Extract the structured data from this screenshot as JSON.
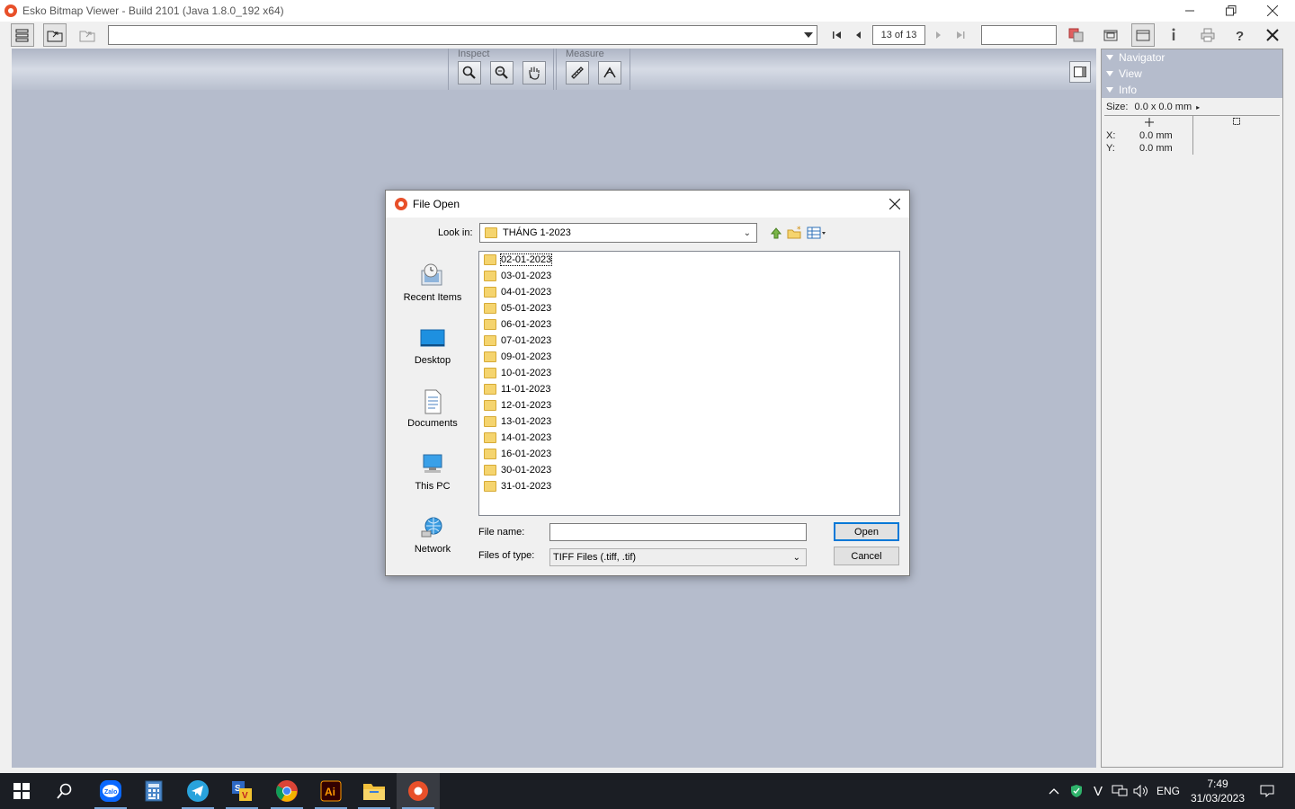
{
  "window": {
    "title": "Esko Bitmap Viewer - Build 2101 (Java 1.8.0_192 x64)",
    "controls": [
      "minimize",
      "maximize",
      "close"
    ]
  },
  "toolbar": {
    "path_value": "",
    "page_indicator": "13 of 13",
    "zoom_value": ""
  },
  "toolstrip": {
    "inspect_label": "Inspect",
    "measure_label": "Measure"
  },
  "right_panel": {
    "sections": [
      "Navigator",
      "View",
      "Info"
    ],
    "size_label": "Size:",
    "size_value": "0.0 x 0.0 mm",
    "x_label": "X:",
    "x_value": "0.0 mm",
    "y_label": "Y:",
    "y_value": "0.0 mm"
  },
  "dialog": {
    "title": "File Open",
    "look_in_label": "Look in:",
    "look_in_value": "THÁNG 1-2023",
    "places": [
      "Recent Items",
      "Desktop",
      "Documents",
      "This PC",
      "Network"
    ],
    "folders": [
      "02-01-2023",
      "03-01-2023",
      "04-01-2023",
      "05-01-2023",
      "06-01-2023",
      "07-01-2023",
      "09-01-2023",
      "10-01-2023",
      "11-01-2023",
      "12-01-2023",
      "13-01-2023",
      "14-01-2023",
      "16-01-2023",
      "30-01-2023",
      "31-01-2023"
    ],
    "file_name_label": "File name:",
    "file_name_value": "",
    "file_type_label": "Files of type:",
    "file_type_value": "TIFF Files (.tiff, .tif)",
    "open_label": "Open",
    "cancel_label": "Cancel"
  },
  "taskbar": {
    "apps": [
      "start",
      "search",
      "zalo",
      "calculator",
      "telegram",
      "unikey",
      "chrome",
      "illustrator",
      "file-explorer",
      "esko-bitmap-viewer"
    ],
    "language": "ENG",
    "time": "7:49",
    "date": "31/03/2023"
  }
}
